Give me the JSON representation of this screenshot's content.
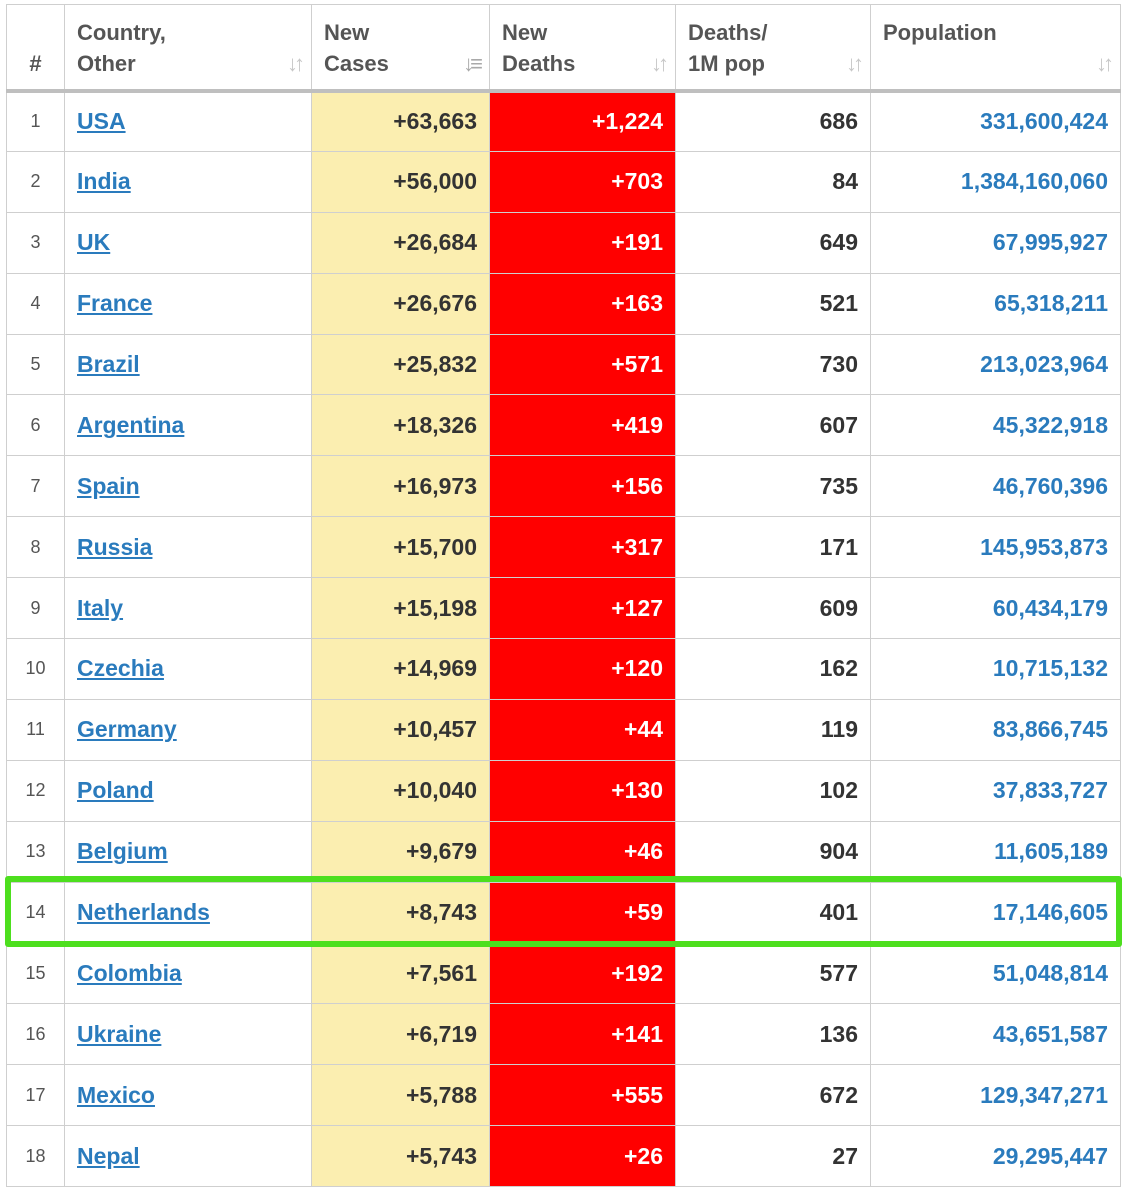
{
  "headers": {
    "rank": "#",
    "country": "Country,\nOther",
    "new_cases": "New\nCases",
    "new_deaths": "New\nDeaths",
    "deaths_per_1m": "Deaths/\n1M pop",
    "population": "Population"
  },
  "sort_icons": {
    "inactive": "sort-both-icon",
    "active": "sort-descending-icon",
    "sorted_column": "new_cases"
  },
  "highlight": {
    "row_rank": "14",
    "color": "#4ddf1e"
  },
  "colors": {
    "new_cases_bg": "#fbeeb0",
    "new_deaths_bg": "#ff0000",
    "link": "#2a7bbd"
  },
  "rows": [
    {
      "rank": "1",
      "country": "USA",
      "new_cases": "+63,663",
      "new_deaths": "+1,224",
      "deaths_per_1m": "686",
      "population": "331,600,424"
    },
    {
      "rank": "2",
      "country": "India",
      "new_cases": "+56,000",
      "new_deaths": "+703",
      "deaths_per_1m": "84",
      "population": "1,384,160,060"
    },
    {
      "rank": "3",
      "country": "UK",
      "new_cases": "+26,684",
      "new_deaths": "+191",
      "deaths_per_1m": "649",
      "population": "67,995,927"
    },
    {
      "rank": "4",
      "country": "France",
      "new_cases": "+26,676",
      "new_deaths": "+163",
      "deaths_per_1m": "521",
      "population": "65,318,211"
    },
    {
      "rank": "5",
      "country": "Brazil",
      "new_cases": "+25,832",
      "new_deaths": "+571",
      "deaths_per_1m": "730",
      "population": "213,023,964"
    },
    {
      "rank": "6",
      "country": "Argentina",
      "new_cases": "+18,326",
      "new_deaths": "+419",
      "deaths_per_1m": "607",
      "population": "45,322,918"
    },
    {
      "rank": "7",
      "country": "Spain",
      "new_cases": "+16,973",
      "new_deaths": "+156",
      "deaths_per_1m": "735",
      "population": "46,760,396"
    },
    {
      "rank": "8",
      "country": "Russia",
      "new_cases": "+15,700",
      "new_deaths": "+317",
      "deaths_per_1m": "171",
      "population": "145,953,873"
    },
    {
      "rank": "9",
      "country": "Italy",
      "new_cases": "+15,198",
      "new_deaths": "+127",
      "deaths_per_1m": "609",
      "population": "60,434,179"
    },
    {
      "rank": "10",
      "country": "Czechia",
      "new_cases": "+14,969",
      "new_deaths": "+120",
      "deaths_per_1m": "162",
      "population": "10,715,132"
    },
    {
      "rank": "11",
      "country": "Germany",
      "new_cases": "+10,457",
      "new_deaths": "+44",
      "deaths_per_1m": "119",
      "population": "83,866,745"
    },
    {
      "rank": "12",
      "country": "Poland",
      "new_cases": "+10,040",
      "new_deaths": "+130",
      "deaths_per_1m": "102",
      "population": "37,833,727"
    },
    {
      "rank": "13",
      "country": "Belgium",
      "new_cases": "+9,679",
      "new_deaths": "+46",
      "deaths_per_1m": "904",
      "population": "11,605,189"
    },
    {
      "rank": "14",
      "country": "Netherlands",
      "new_cases": "+8,743",
      "new_deaths": "+59",
      "deaths_per_1m": "401",
      "population": "17,146,605"
    },
    {
      "rank": "15",
      "country": "Colombia",
      "new_cases": "+7,561",
      "new_deaths": "+192",
      "deaths_per_1m": "577",
      "population": "51,048,814"
    },
    {
      "rank": "16",
      "country": "Ukraine",
      "new_cases": "+6,719",
      "new_deaths": "+141",
      "deaths_per_1m": "136",
      "population": "43,651,587"
    },
    {
      "rank": "17",
      "country": "Mexico",
      "new_cases": "+5,788",
      "new_deaths": "+555",
      "deaths_per_1m": "672",
      "population": "129,347,271"
    },
    {
      "rank": "18",
      "country": "Nepal",
      "new_cases": "+5,743",
      "new_deaths": "+26",
      "deaths_per_1m": "27",
      "population": "29,295,447"
    }
  ]
}
